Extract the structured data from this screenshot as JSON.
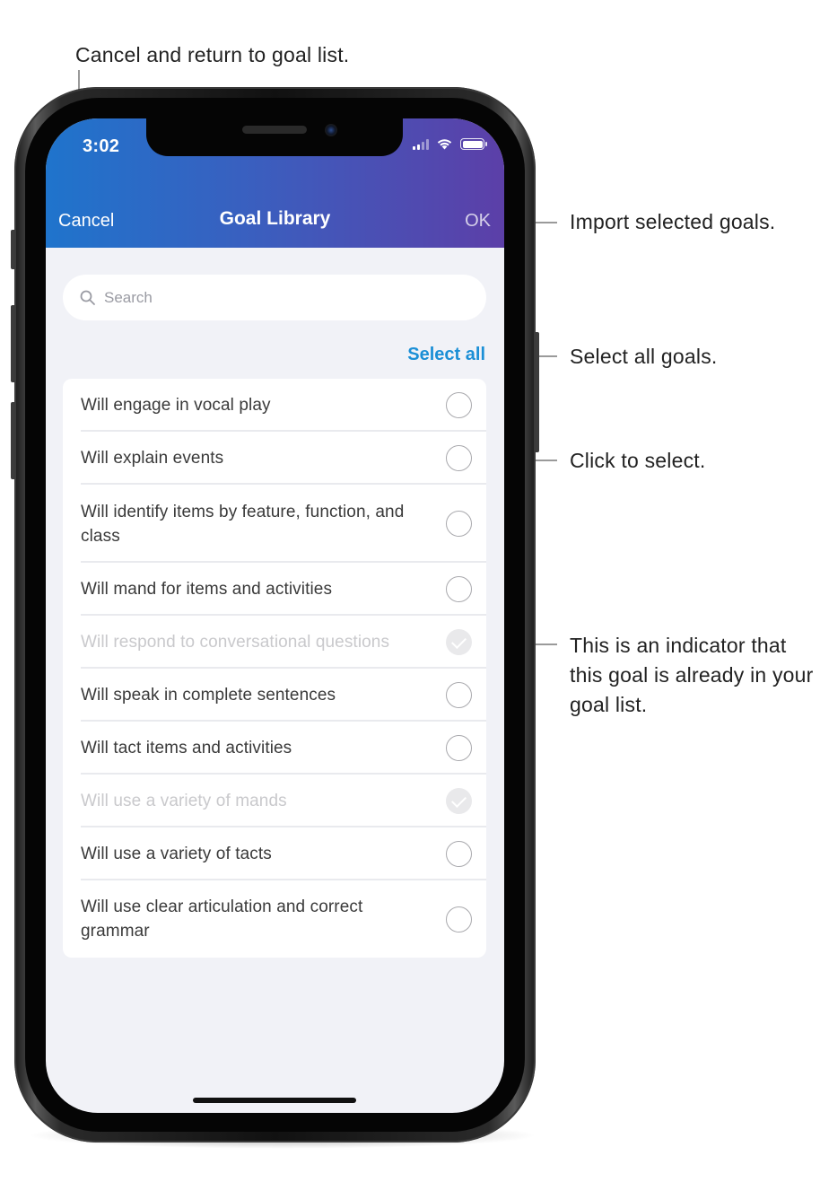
{
  "annotations": {
    "cancel": "Cancel and return to goal list.",
    "ok": "Import selected goals.",
    "select_all": "Select all goals.",
    "click_select": "Click to select.",
    "indicator": "This is an indicator that this goal is already in your goal list."
  },
  "status_bar": {
    "time": "3:02",
    "icons": [
      "signal-icon",
      "wifi-icon",
      "battery-icon"
    ]
  },
  "nav": {
    "cancel_label": "Cancel",
    "title": "Goal Library",
    "ok_label": "OK"
  },
  "search": {
    "placeholder": "Search",
    "value": ""
  },
  "select_all_label": "Select all",
  "goals": [
    {
      "label": "Will engage in vocal play",
      "state": "unselected"
    },
    {
      "label": "Will explain events",
      "state": "unselected"
    },
    {
      "label": "Will identify items by feature, function, and class",
      "state": "unselected"
    },
    {
      "label": "Will mand for items and activities",
      "state": "unselected"
    },
    {
      "label": "Will respond to conversational questions",
      "state": "already-added"
    },
    {
      "label": "Will speak in complete sentences",
      "state": "unselected"
    },
    {
      "label": "Will tact items and activities",
      "state": "unselected"
    },
    {
      "label": "Will use a variety of mands",
      "state": "already-added"
    },
    {
      "label": "Will use a variety of tacts",
      "state": "unselected"
    },
    {
      "label": "Will use clear articulation and correct grammar",
      "state": "unselected"
    }
  ],
  "colors": {
    "header_gradient_start": "#1f74cc",
    "header_gradient_end": "#5c3fa8",
    "accent": "#1b8fd6",
    "background": "#f1f2f7"
  }
}
